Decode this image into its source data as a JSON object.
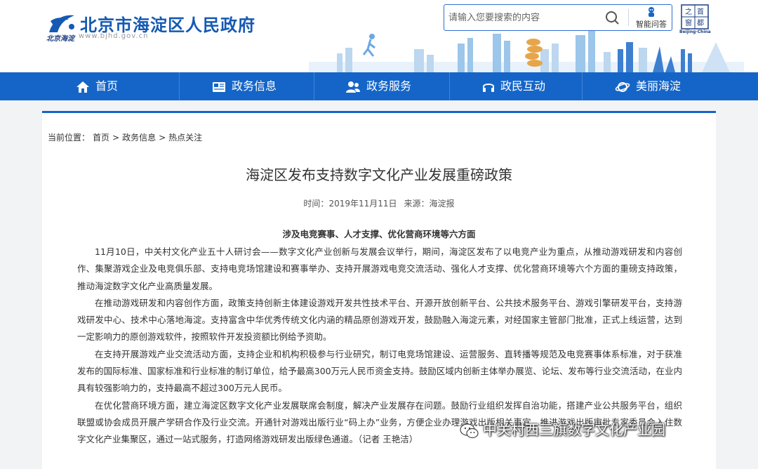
{
  "header": {
    "site_name": "北京市海淀区人民政府",
    "logo_sub": "北京海淀",
    "domain": "www.bjhd.gov.cn",
    "search_placeholder": "请输入您要搜索的内容",
    "qa_label": "智能问答",
    "capital_badge_chars": [
      "首",
      "都",
      "之",
      "窗"
    ],
    "capital_badge_sub": "Beijing·China"
  },
  "nav": {
    "items": [
      {
        "label": "首页",
        "icon": "home-icon"
      },
      {
        "label": "政务信息",
        "icon": "news-icon"
      },
      {
        "label": "政务服务",
        "icon": "users-icon"
      },
      {
        "label": "政民互动",
        "icon": "headset-icon"
      },
      {
        "label": "美丽海淀",
        "icon": "planet-icon"
      }
    ]
  },
  "breadcrumb": {
    "prefix": "当前位置：",
    "items": [
      "首页",
      "政务信息",
      "热点关注"
    ],
    "separator": ">"
  },
  "article": {
    "title": "海淀区发布支持数字文化产业发展重磅政策",
    "date_label": "时间：",
    "date": "2019年11月11日",
    "source_label": "来源：",
    "source": "海淀报",
    "subtitle": "涉及电竞赛事、人才支撑、优化营商环境等六方面",
    "paragraphs": [
      "11月10日，中关村文化产业五十人研讨会——数字文化产业创新与发展会议举行，期间，海淀区发布了以电竞产业为重点，从推动游戏研发和内容创作、集聚游戏企业及电竞俱乐部、支持电竞场馆建设和赛事举办、支持开展游戏电竞交流活动、强化人才支撑、优化营商环境等六个方面的重磅支持政策，推动海淀数字文化产业高质量发展。",
      "在推动游戏研发和内容创作方面，政策支持创新主体建设游戏开发共性技术平台、开源开放创新平台、公共技术服务平台、游戏引擎研发平台，支持游戏研发中心、技术中心落地海淀。支持富含中华优秀传统文化内涵的精品原创游戏开发，鼓励融入海淀元素，对经国家主管部门批准，正式上线运营，达到一定影响力的原创游戏软件，按照软件开发投资额比例给予资助。",
      "在支持开展游戏产业交流活动方面，支持企业和机构积极参与行业研究，制订电竞场馆建设、运营服务、直转播等规范及电竞赛事体系标准，对于获准发布的国际标准、国家标准和行业标准的制订单位，给予最高300万元人民币资金支持。鼓励区域内创新主体举办展览、论坛、发布等行业交流活动，在业内具有较强影响力的，支持最高不超过300万元人民币。",
      "在优化营商环境方面，建立海淀区数字文化产业发展联席会制度，解决产业发展存在问题。鼓励行业组织发挥自治功能，搭建产业公共服务平台，组织联盟或协会成员开展产学研合作及行业交流。开通针对游戏出版行业“码上办”业务，方便企业办理游戏出版相关事宜，推进游戏出版审批专家委员会入住数字文化产业集聚区，通过一站式服务，打造网络游戏研发出版绿色通道。（记者 王艳洁）"
    ]
  },
  "watermark": "中关村西三旗数字文化产业园",
  "colors": {
    "brand_blue": "#1565c8",
    "title_blue": "#1559b3",
    "page_bg": "#f1f3f5"
  }
}
